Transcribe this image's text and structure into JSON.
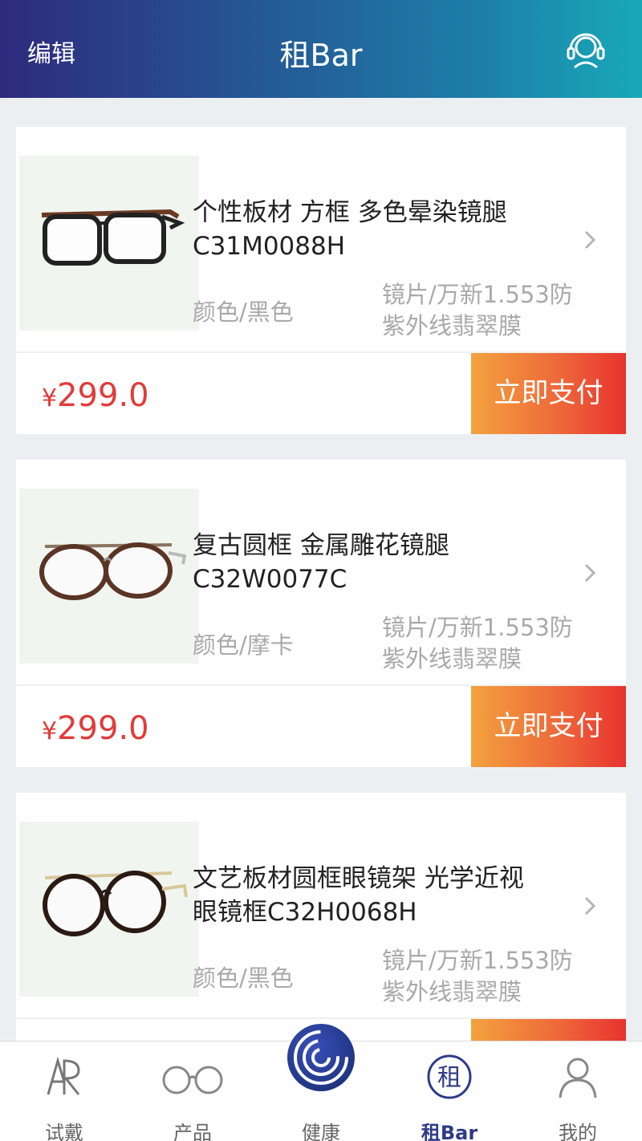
{
  "header": {
    "edit_label": "编辑",
    "title": "租Bar",
    "service_icon": "customer-service-headset-icon"
  },
  "products": [
    {
      "name_line1": "个性板材 方框 多色晕染镜腿",
      "name_line2": "C31M0088H",
      "color": "颜色/黑色",
      "lens_line1": "镜片/万新1.553防",
      "lens_line2": "紫外线翡翠膜",
      "currency": "¥",
      "price": "299.0",
      "pay_label": "立即支付"
    },
    {
      "name_line1": "复古圆框 金属雕花镜腿",
      "name_line2": "C32W0077C",
      "color": "颜色/摩卡",
      "lens_line1": "镜片/万新1.553防",
      "lens_line2": "紫外线翡翠膜",
      "currency": "¥",
      "price": "299.0",
      "pay_label": "立即支付"
    },
    {
      "name_line1": "文艺板材圆框眼镜架 光学近视",
      "name_line2": "眼镜框C32H0068H",
      "color": "颜色/黑色",
      "lens_line1": "镜片/万新1.553防",
      "lens_line2": "紫外线翡翠膜",
      "currency": "",
      "price": "",
      "pay_label": ""
    }
  ],
  "tabbar": {
    "items": [
      {
        "label": "试戴",
        "icon": "ar-icon"
      },
      {
        "label": "产品",
        "icon": "glasses-icon"
      },
      {
        "label": "健康",
        "icon": "health-logo-icon"
      },
      {
        "label": "租Bar",
        "icon": "rent-icon",
        "icon_text": "租"
      },
      {
        "label": "我的",
        "icon": "user-icon"
      }
    ],
    "active": "租Bar"
  },
  "colors": {
    "header_start": "#2e2a7e",
    "header_end": "#18a9b9",
    "price": "#e33a3a",
    "pay_start": "#f3a23f",
    "pay_end": "#e7332f",
    "active_tab": "#2e3b86"
  }
}
